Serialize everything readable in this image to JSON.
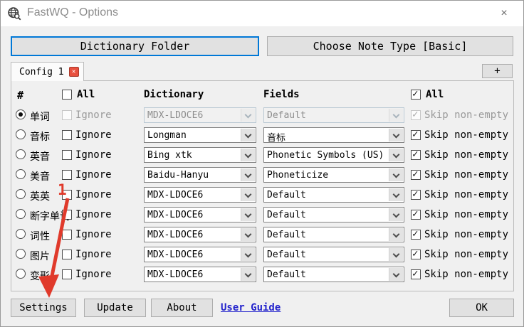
{
  "window": {
    "title": "FastWQ - Options",
    "close_glyph": "×"
  },
  "toolbar": {
    "dictionary_folder_label": "Dictionary Folder",
    "choose_note_type_label": "Choose Note Type [Basic]"
  },
  "tab_bar": {
    "config_tab_label": "Config 1",
    "tab_close_glyph": "✕",
    "add_tab_label": "+"
  },
  "table": {
    "col_hash": "#",
    "all_left_label": "All",
    "all_left_checked": false,
    "col_dictionary": "Dictionary",
    "col_fields": "Fields",
    "all_right_label": "All",
    "all_right_checked": true,
    "ignore_label": "Ignore",
    "skip_label": "Skip non-empty",
    "rows": [
      {
        "label": "单词",
        "selected": true,
        "disabled": true,
        "ignore": false,
        "dictionary": "MDX-LDOCE6",
        "field": "Default",
        "skip": true
      },
      {
        "label": "音标",
        "selected": false,
        "disabled": false,
        "ignore": false,
        "dictionary": "Longman",
        "field": "音标",
        "skip": true
      },
      {
        "label": "英音",
        "selected": false,
        "disabled": false,
        "ignore": false,
        "dictionary": "Bing xtk",
        "field": "Phonetic Symbols (US)",
        "skip": true
      },
      {
        "label": "美音",
        "selected": false,
        "disabled": false,
        "ignore": false,
        "dictionary": "Baidu-Hanyu",
        "field": "Phoneticize",
        "skip": true
      },
      {
        "label": "英英",
        "selected": false,
        "disabled": false,
        "ignore": false,
        "dictionary": "MDX-LDOCE6",
        "field": "Default",
        "skip": true
      },
      {
        "label": "断字单词",
        "selected": false,
        "disabled": false,
        "ignore": false,
        "dictionary": "MDX-LDOCE6",
        "field": "Default",
        "skip": true
      },
      {
        "label": "词性",
        "selected": false,
        "disabled": false,
        "ignore": false,
        "dictionary": "MDX-LDOCE6",
        "field": "Default",
        "skip": true
      },
      {
        "label": "图片",
        "selected": false,
        "disabled": false,
        "ignore": false,
        "dictionary": "MDX-LDOCE6",
        "field": "Default",
        "skip": true
      },
      {
        "label": "变形",
        "selected": false,
        "disabled": false,
        "ignore": false,
        "dictionary": "MDX-LDOCE6",
        "field": "Default",
        "skip": true
      }
    ]
  },
  "footer": {
    "settings_label": "Settings",
    "update_label": "Update",
    "about_label": "About",
    "user_guide_label": "User Guide",
    "ok_label": "OK"
  },
  "annotation": {
    "step_number": "1"
  },
  "colors": {
    "accent_blue": "#0078d7",
    "annotation_red": "#e03a2b",
    "link_blue": "#2323cc"
  }
}
